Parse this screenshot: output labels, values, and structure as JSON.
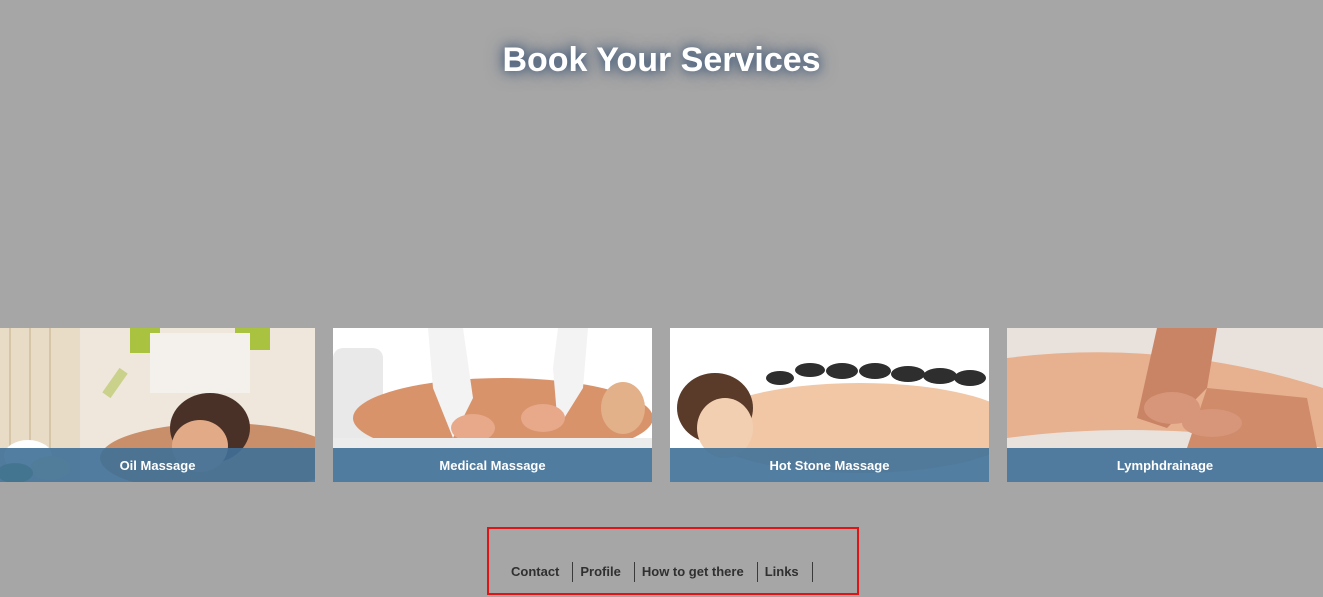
{
  "page": {
    "title": "Book Your Services",
    "background_color": "#a6a6a6"
  },
  "services": [
    {
      "label": "Oil Massage",
      "image": "oil-massage-photo"
    },
    {
      "label": "Medical Massage",
      "image": "medical-massage-photo"
    },
    {
      "label": "Hot Stone Massage",
      "image": "hot-stone-massage-photo"
    },
    {
      "label": "Lymphdrainage",
      "image": "lymphdrainage-photo"
    }
  ],
  "footer": {
    "links": [
      "Contact",
      "Profile",
      "How to get there",
      "Links"
    ],
    "highlight_color": "#e01414"
  },
  "colors": {
    "label_bar": "#3f7098",
    "title_text": "#ffffff",
    "footer_text": "#303030"
  }
}
